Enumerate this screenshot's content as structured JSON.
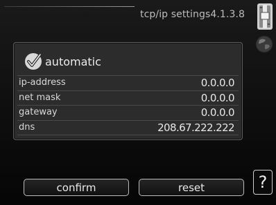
{
  "header": {
    "title": "tcp/ip settings4.1.3.8"
  },
  "panel": {
    "automatic_label": "automatic",
    "automatic_checked": true,
    "rows": [
      {
        "label": "ip-address",
        "value": "0.0.0.0"
      },
      {
        "label": "net mask",
        "value": "0.0.0.0"
      },
      {
        "label": "gateway",
        "value": "0.0.0.0"
      },
      {
        "label": "dns",
        "value": "208.67.222.222"
      }
    ]
  },
  "buttons": {
    "confirm_label": "confirm",
    "reset_label": "reset",
    "help_label": "?"
  },
  "icons": {
    "scroll": "slider-scroll-icon",
    "globe": "globe-icon",
    "check": "checkmark-icon"
  }
}
